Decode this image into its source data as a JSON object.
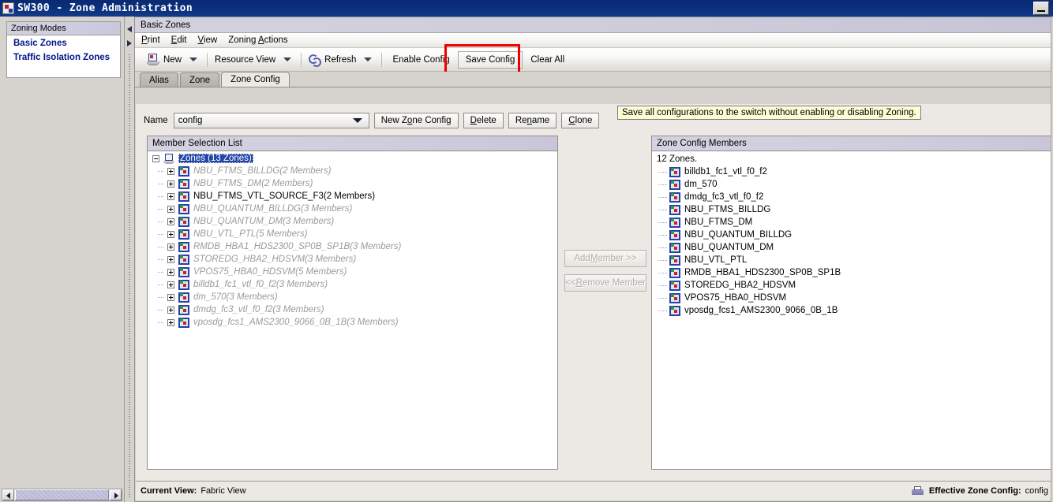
{
  "window": {
    "title": "SW300 - Zone Administration",
    "app_icon": "app-window-icon",
    "minimize_label": "Minimize"
  },
  "sidebar": {
    "panel_title": "Zoning Modes",
    "items": [
      {
        "label": "Basic Zones"
      },
      {
        "label": "Traffic Isolation Zones"
      }
    ]
  },
  "frame": {
    "title": "Basic Zones"
  },
  "menubar": {
    "items": [
      {
        "pre": "",
        "mnemonic": "P",
        "post": "rint"
      },
      {
        "pre": "",
        "mnemonic": "E",
        "post": "dit"
      },
      {
        "pre": "",
        "mnemonic": "V",
        "post": "iew"
      },
      {
        "pre": "Zoning ",
        "mnemonic": "A",
        "post": "ctions"
      }
    ]
  },
  "toolbar": {
    "new_label": "New",
    "resource_view_label": "Resource View",
    "refresh_label": "Refresh",
    "enable_config_label": "Enable Config",
    "save_config_label": "Save Config",
    "clear_all_label": "Clear All",
    "tooltip": "Save all configurations to the switch without enabling or disabling Zoning.",
    "highlight_color": "#ee0000"
  },
  "tabs": [
    {
      "label": "Alias",
      "active": false
    },
    {
      "label": "Zone",
      "active": false
    },
    {
      "label": "Zone Config",
      "active": true
    }
  ],
  "name_row": {
    "label": "Name",
    "combo_value": "config",
    "buttons": [
      {
        "pre": "New Z",
        "mnemonic": "o",
        "post": "ne Config"
      },
      {
        "pre": "",
        "mnemonic": "D",
        "post": "elete"
      },
      {
        "pre": "Re",
        "mnemonic": "n",
        "post": "ame"
      },
      {
        "pre": "",
        "mnemonic": "C",
        "post": "lone"
      }
    ]
  },
  "member_selection": {
    "header": "Member Selection List",
    "root": {
      "label": "Zones (13 Zones)",
      "selected": true,
      "expanded": true
    },
    "items": [
      {
        "label": "NBU_FTMS_BILLDG(2 Members)",
        "style": "dim"
      },
      {
        "label": "NBU_FTMS_DM(2 Members)",
        "style": "dim"
      },
      {
        "label": "NBU_FTMS_VTL_SOURCE_F3(2 Members)",
        "style": "normal"
      },
      {
        "label": "NBU_QUANTUM_BILLDG(3 Members)",
        "style": "dim"
      },
      {
        "label": "NBU_QUANTUM_DM(3 Members)",
        "style": "dim"
      },
      {
        "label": "NBU_VTL_PTL(5 Members)",
        "style": "dim"
      },
      {
        "label": "RMDB_HBA1_HDS2300_SP0B_SP1B(3 Members)",
        "style": "dim"
      },
      {
        "label": "STOREDG_HBA2_HDSVM(3 Members)",
        "style": "dim"
      },
      {
        "label": "VPOS75_HBA0_HDSVM(5 Members)",
        "style": "dim"
      },
      {
        "label": "billdb1_fc1_vtl_f0_f2(3 Members)",
        "style": "dim"
      },
      {
        "label": "dm_570(3 Members)",
        "style": "dim"
      },
      {
        "label": "dmdg_fc3_vtl_f0_f2(3 Members)",
        "style": "dim"
      },
      {
        "label": "vposdg_fcs1_AMS2300_9066_0B_1B(3 Members)",
        "style": "dim"
      }
    ]
  },
  "mid_buttons": {
    "add": {
      "pre": "Add ",
      "mnemonic": "M",
      "post": "ember >>",
      "enabled": false
    },
    "remove": {
      "pre": "<< ",
      "mnemonic": "R",
      "post": "emove Member",
      "enabled": false
    }
  },
  "zone_config_members": {
    "header": "Zone Config Members",
    "count_text": "12 Zones.",
    "items": [
      {
        "label": "billdb1_fc1_vtl_f0_f2"
      },
      {
        "label": "dm_570"
      },
      {
        "label": "dmdg_fc3_vtl_f0_f2"
      },
      {
        "label": "NBU_FTMS_BILLDG"
      },
      {
        "label": "NBU_FTMS_DM"
      },
      {
        "label": "NBU_QUANTUM_BILLDG"
      },
      {
        "label": "NBU_QUANTUM_DM"
      },
      {
        "label": "NBU_VTL_PTL"
      },
      {
        "label": "RMDB_HBA1_HDS2300_SP0B_SP1B"
      },
      {
        "label": "STOREDG_HBA2_HDSVM"
      },
      {
        "label": "VPOS75_HBA0_HDSVM"
      },
      {
        "label": "vposdg_fcs1_AMS2300_9066_0B_1B"
      }
    ]
  },
  "statusbar": {
    "current_view_label": "Current View:",
    "current_view_value": "Fabric View",
    "effective_zone_config_label": "Effective Zone Config:",
    "effective_zone_config_value": "config"
  }
}
